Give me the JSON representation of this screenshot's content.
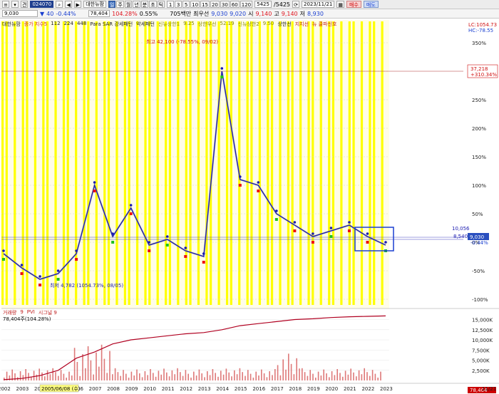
{
  "toolbar1": {
    "view_btn": "견",
    "stock_code": "024070",
    "stock_name": "대한뉴팜",
    "period_tabs": [
      "일",
      "주",
      "월",
      "년",
      "분",
      "초",
      "틱"
    ],
    "numbers": [
      "1",
      "3",
      "5",
      "10",
      "15",
      "20",
      "30",
      "60",
      "120"
    ],
    "count_value": "5425",
    "count_total": "/5425",
    "date": "2023/11/21",
    "buy_label": "매수",
    "sell_label": "매도"
  },
  "toolbar2": {
    "price": "9,030",
    "change": "40",
    "change_pct": "-0.44%",
    "volume": "78,404",
    "volume_ratio": "104.28%",
    "turnover": "0.55%",
    "amount": "705백만",
    "lowest_label": "최우선",
    "lowest_val": "9,030",
    "bid": "9,020",
    "open_label": "시",
    "open": "9,140",
    "high_label": "고",
    "high": "9,140",
    "low_label": "저",
    "low": "8,930"
  },
  "legend": [
    {
      "label": "대한뉴팜",
      "color": "#222222"
    },
    {
      "label": "종가 지수5",
      "color": "#d33333"
    },
    {
      "label": "112",
      "color": "#222222"
    },
    {
      "label": "224",
      "color": "#222222"
    },
    {
      "label": "448",
      "color": "#222222"
    },
    {
      "label": "Para SAR 강세패턴",
      "color": "#222222"
    },
    {
      "label": "약세패턴",
      "color": "#222222"
    },
    {
      "label": "신뉴상한1",
      "color": "#888800"
    },
    {
      "label": "9.25",
      "color": "#888800"
    },
    {
      "label": "상한우선",
      "color": "#888800"
    },
    {
      "label": "52.19",
      "color": "#888800"
    },
    {
      "label": "신뉴상한2",
      "color": "#888800"
    },
    {
      "label": "9.50",
      "color": "#888800"
    },
    {
      "label": "상한선",
      "color": "#222222"
    },
    {
      "label": "지지선",
      "color": "#c02020"
    },
    {
      "label": "뉴 클파신호",
      "color": "#c02020"
    }
  ],
  "annotations": {
    "peak": "최고 42,100 (-78.55%, 09/02)",
    "low": "최저 4,782 (1054.73%, 08/05)",
    "lc": "LC:1054.73",
    "hc": "HC:-78.55",
    "marker_price": "37,218",
    "marker_pct": "+310.34%",
    "level_a": "10,056",
    "level_b": "8,540",
    "current_price": "9,030",
    "current_pct": "-0.44%",
    "date_highlight": "2005/06/08 (수)",
    "vol_last": "78,404",
    "vol_pct": "104.28%"
  },
  "volume_legend": [
    {
      "label": "거래량",
      "color": "#c02020"
    },
    {
      "label": "9",
      "color": "#c02020"
    },
    {
      "label": "PVI",
      "color": "#c02020"
    },
    {
      "label": "시그널 9",
      "color": "#c02020"
    }
  ],
  "volume_values": "78,404주(104.28%)",
  "chart_data": {
    "type": "line",
    "title": "대한뉴팜",
    "x": [
      "2002",
      "2003",
      "2004",
      "2005",
      "2006",
      "2007",
      "2008",
      "2009",
      "2010",
      "2011",
      "2012",
      "2013",
      "2014",
      "2015",
      "2016",
      "2017",
      "2018",
      "2019",
      "2020",
      "2021",
      "2022",
      "2023"
    ],
    "series": [
      {
        "name": "대한뉴팜",
        "values": [
          -20,
          -45,
          -65,
          -55,
          -20,
          100,
          10,
          60,
          -5,
          5,
          -15,
          -25,
          300,
          110,
          100,
          50,
          30,
          10,
          20,
          30,
          10,
          -5
        ]
      },
      {
        "name": "PVI",
        "values": [
          200,
          500,
          1200,
          2500,
          5500,
          7000,
          9000,
          10000,
          10500,
          11000,
          11500,
          11800,
          12500,
          13500,
          14000,
          14500,
          15000,
          15200,
          15500,
          15700,
          15800,
          15900
        ]
      }
    ],
    "y_ticks": [
      "350%",
      "300%",
      "250%",
      "200%",
      "150%",
      "100%",
      "50%",
      "0%",
      "-50%",
      "-100%"
    ],
    "volume_ticks": [
      "15,000K",
      "12,500K",
      "10,000K",
      "7,500K",
      "5,000K",
      "2,500K"
    ],
    "ylim": [
      -110,
      380
    ],
    "grid": true
  },
  "colors": {
    "yellow_band": "#ffff00",
    "price_line": "#1a1ab0",
    "ma_line": "#9090a0",
    "up_marker": "#ee1010",
    "down_marker": "#20c020",
    "pvi_line": "#b00020",
    "volume_bar": "#d04040"
  }
}
